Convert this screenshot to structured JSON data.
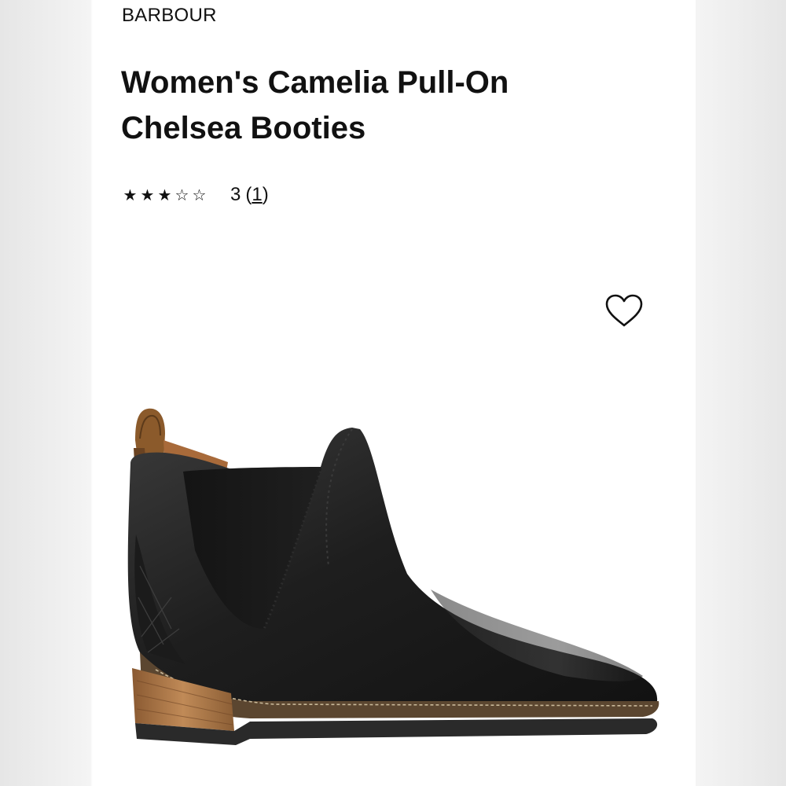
{
  "product": {
    "brand": "BARBOUR",
    "title": "Women's Camelia Pull-On Chelsea Booties",
    "rating": {
      "value": "3",
      "max": 5,
      "stars": [
        "★",
        "★",
        "★",
        "☆",
        "☆"
      ],
      "review_count": "1"
    },
    "wishlist_icon": "heart-outline-icon",
    "image_subject": "black leather chelsea ankle boot"
  },
  "colors": {
    "text": "#111111",
    "background": "#ffffff",
    "side_panels": "#ececec"
  }
}
